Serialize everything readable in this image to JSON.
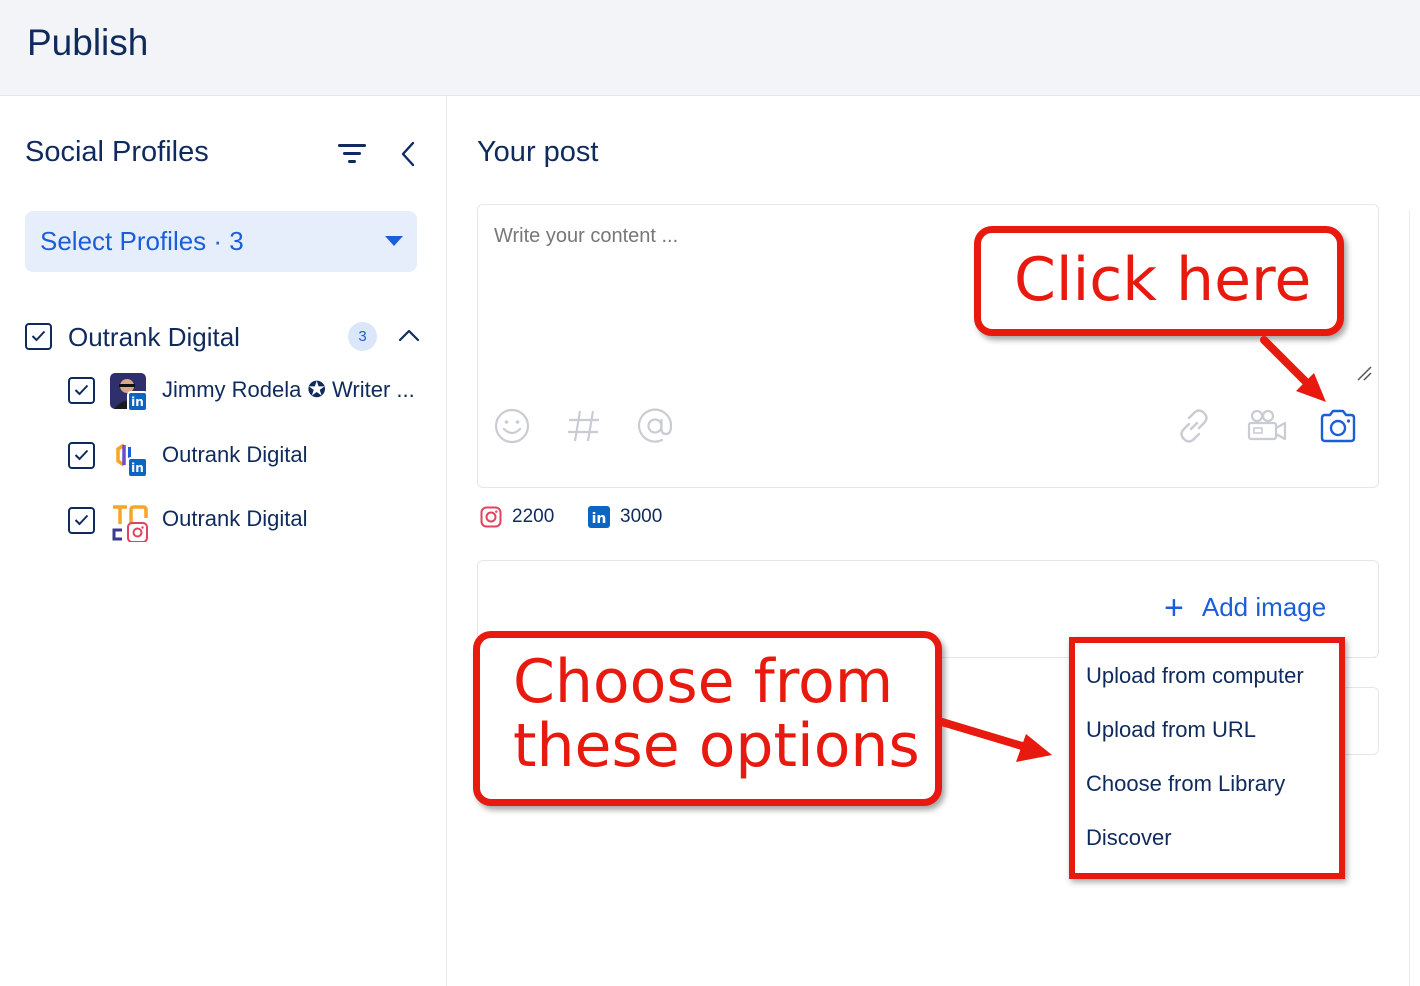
{
  "header": {
    "title": "Publish"
  },
  "sidebar": {
    "title": "Social Profiles",
    "select_label": "Select Profiles · 3",
    "group": {
      "name": "Outrank Digital",
      "count": "3"
    },
    "profiles": [
      {
        "name": "Jimmy Rodela ✪ Writer ...",
        "network": "linkedin"
      },
      {
        "name": "Outrank Digital",
        "network": "linkedin"
      },
      {
        "name": "Outrank Digital",
        "network": "instagram"
      }
    ]
  },
  "main": {
    "title": "Your post",
    "editor_placeholder": "Write your content ...",
    "counters": [
      {
        "network": "instagram",
        "value": "2200"
      },
      {
        "network": "linkedin",
        "value": "3000"
      }
    ],
    "add_image_label": "Add image",
    "add_image_plus": "+",
    "menu": [
      "Upload from computer",
      "Upload from URL",
      "Choose from Library",
      "Discover"
    ]
  },
  "annotations": {
    "callout_click": "Click here",
    "callout_choose_line1": "Choose from",
    "callout_choose_line2": "these options",
    "color": "#e8190f"
  },
  "colors": {
    "brand": "#1a5fd8",
    "text": "#0f2a5c",
    "instagram": "#e4405f",
    "linkedin": "#0a66c2"
  }
}
